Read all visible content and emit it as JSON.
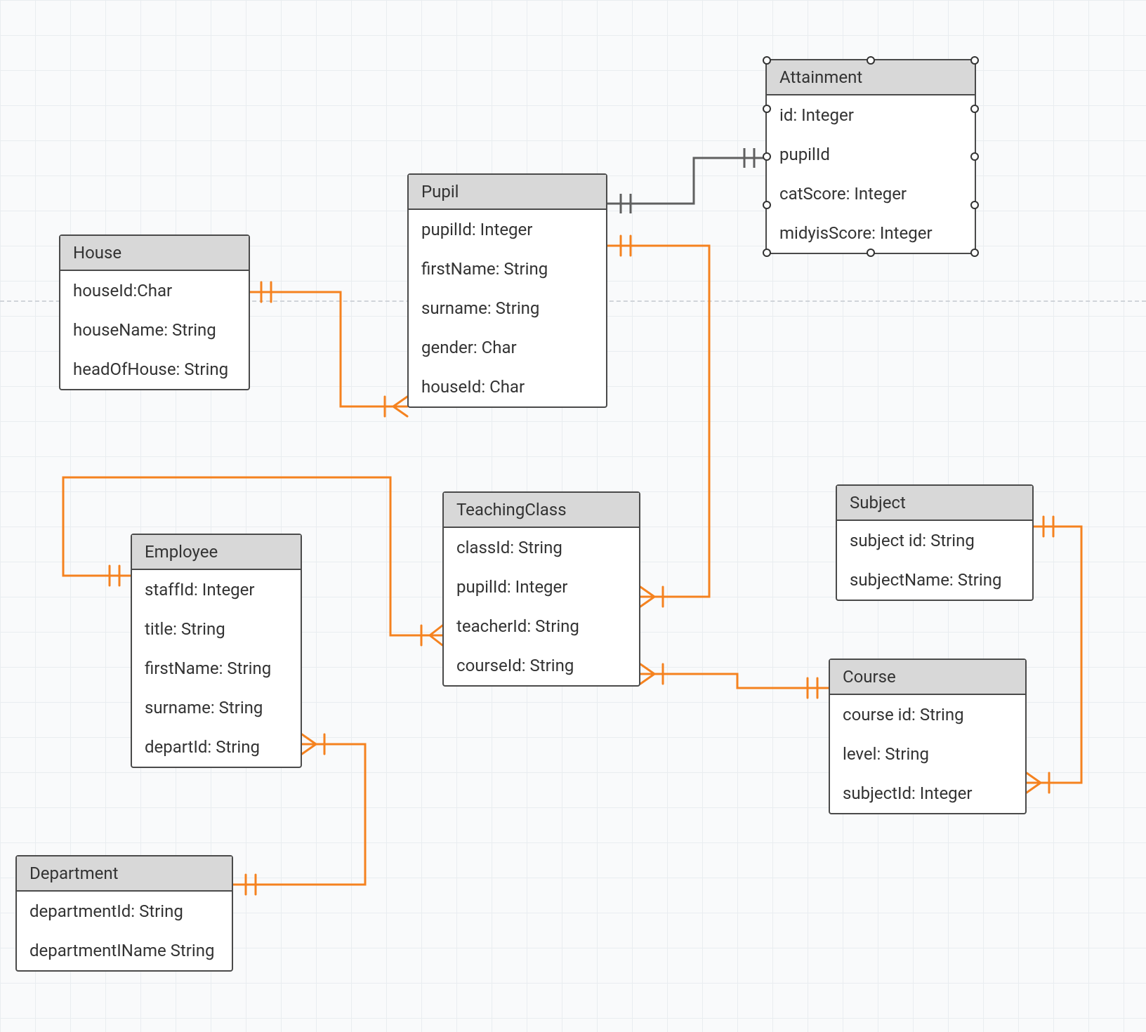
{
  "entities": {
    "house": {
      "title": "House",
      "attrs": [
        "houseId:Char",
        "houseName: String",
        "headOfHouse: String"
      ]
    },
    "pupil": {
      "title": "Pupil",
      "attrs": [
        "pupilId: Integer",
        "firstName: String",
        "surname: String",
        "gender: Char",
        "houseId: Char"
      ]
    },
    "attainment": {
      "title": "Attainment",
      "attrs": [
        "id: Integer",
        "pupilId",
        "catScore: Integer",
        "midyisScore: Integer"
      ]
    },
    "teachingClass": {
      "title": "TeachingClass",
      "attrs": [
        "classId: String",
        "pupilId: Integer",
        "teacherId: String",
        "courseId: String"
      ]
    },
    "employee": {
      "title": "Employee",
      "attrs": [
        "staffId: Integer",
        "title: String",
        "firstName: String",
        "surname: String",
        "departId: String"
      ]
    },
    "department": {
      "title": "Department",
      "attrs": [
        "departmentId: String",
        "departmentIName String"
      ]
    },
    "subject": {
      "title": "Subject",
      "attrs": [
        "subject id: String",
        "subjectName: String"
      ]
    },
    "course": {
      "title": "Course",
      "attrs": [
        "course id: String",
        "level: String",
        "subjectId: Integer"
      ]
    }
  },
  "colors": {
    "connector": "#f5821f",
    "selectedConnector": "#606060"
  }
}
